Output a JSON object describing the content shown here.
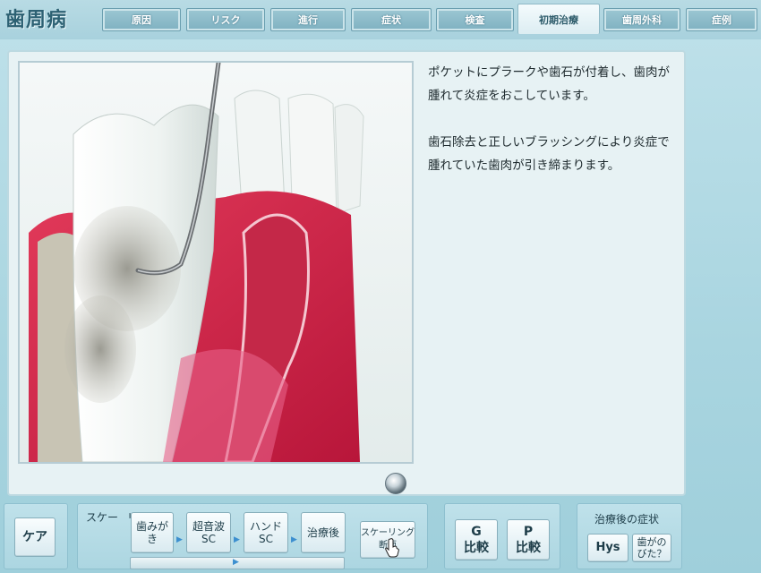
{
  "app": {
    "title": "歯周病"
  },
  "tabs": [
    {
      "label": "原因",
      "active": false
    },
    {
      "label": "リスク",
      "active": false
    },
    {
      "label": "進行",
      "active": false
    },
    {
      "label": "症状",
      "active": false
    },
    {
      "label": "検査",
      "active": false
    },
    {
      "label": "初期治療",
      "active": true
    },
    {
      "label": "歯周外科",
      "active": false
    },
    {
      "label": "症例",
      "active": false
    }
  ],
  "main": {
    "description": [
      "ポケットにプラークや歯石が付着し、歯肉が腫れて炎症をおこしています。",
      "歯石除去と正しいブラッシングにより炎症で腫れていた歯肉が引き締まります。"
    ]
  },
  "bottom": {
    "care_button": "ケア",
    "scaling_label": [
      "スケー",
      "リング"
    ],
    "steps": [
      {
        "lines": [
          "歯みがき"
        ]
      },
      {
        "lines": [
          "超音波",
          "SC"
        ]
      },
      {
        "lines": [
          "ハンド",
          "SC"
        ]
      },
      {
        "lines": [
          "治療後"
        ]
      }
    ],
    "section_button": [
      "スケーリング",
      "断面"
    ],
    "compare": [
      {
        "lines": [
          "G",
          "比較"
        ]
      },
      {
        "lines": [
          "P",
          "比較"
        ]
      }
    ],
    "after_symptoms": {
      "title": "治療後の症状",
      "buttons": [
        {
          "lines": [
            "Hys"
          ]
        },
        {
          "lines": [
            "歯がの",
            "びた？"
          ]
        }
      ]
    }
  },
  "colors": {
    "gum": "#d8304f",
    "tooth": "#f4f7f5",
    "accent": "#3c8fcf"
  }
}
